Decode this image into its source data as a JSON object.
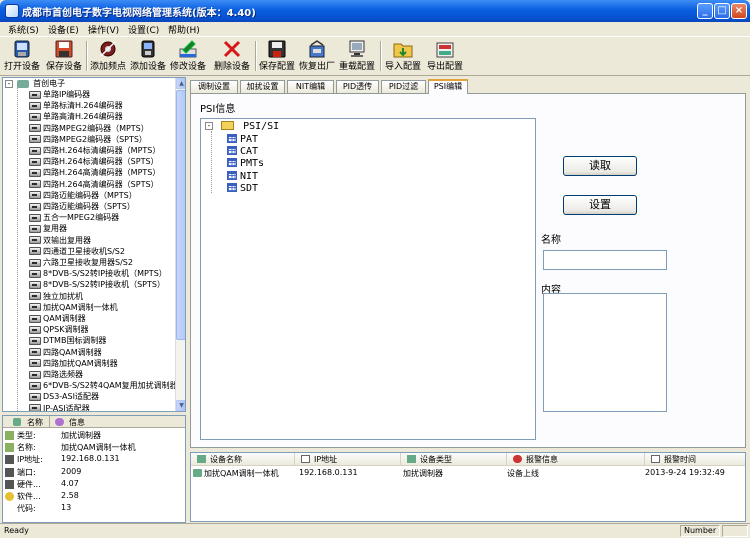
{
  "window": {
    "title": "成都市首创电子数字电视网络管理系统(版本：4.40)",
    "controls": {
      "minimize": "_",
      "maximize": "□",
      "close": "×"
    }
  },
  "menu": [
    "系统(S)",
    "设备(E)",
    "操作(V)",
    "设置(C)",
    "帮助(H)"
  ],
  "toolbar": [
    {
      "label": "打开设备",
      "icon": "open-device-icon"
    },
    {
      "label": "保存设备",
      "icon": "save-device-icon"
    },
    {
      "label": "添加频点",
      "icon": "add-frequency-icon"
    },
    {
      "label": "添加设备",
      "icon": "add-device-icon"
    },
    {
      "label": "修改设备",
      "icon": "edit-device-icon"
    },
    {
      "label": "删除设备",
      "icon": "delete-device-icon"
    },
    {
      "label": "保存配置",
      "icon": "save-config-icon"
    },
    {
      "label": "恢复出厂",
      "icon": "factory-reset-icon"
    },
    {
      "label": "重载配置",
      "icon": "reload-config-icon"
    },
    {
      "label": "导入配置",
      "icon": "import-config-icon"
    },
    {
      "label": "导出配置",
      "icon": "export-config-icon"
    }
  ],
  "tree": {
    "root": "首创电子",
    "items": [
      "单路IP编码器",
      "单路标清H.264编码器",
      "单路高清H.264编码器",
      "四路MPEG2编码器（MPTS）",
      "四路MPEG2编码器（SPTS）",
      "四路H.264标清编码器（MPTS）",
      "四路H.264标清编码器（SPTS）",
      "四路H.264高清编码器（MPTS）",
      "四路H.264高清编码器（SPTS）",
      "四路迈能编码器（MPTS）",
      "四路迈能编码器（SPTS）",
      "五合一MPEG2编码器",
      "复用器",
      "双输出复用器",
      "四通道卫星接收机S/S2",
      "六路卫星接收复用器S/S2",
      "8*DVB-S/S2转IP接收机（MPTS）",
      "8*DVB-S/S2转IP接收机（SPTS）",
      "独立加扰机",
      "加扰QAM调制一体机",
      "QAM调制器",
      "QPSK调制器",
      "DTMB国标调制器",
      "四路QAM调制器",
      "四路加扰QAM调制器",
      "四路选频器",
      "6*DVB-S/S2转4QAM复用加扰调制器",
      "DS3-ASI适配器",
      "IP-ASI适配器"
    ],
    "selected_index": 19
  },
  "info_panel": {
    "headers": [
      "名称",
      "信息"
    ],
    "rows": [
      {
        "key": "类型:",
        "value": "加扰调制器"
      },
      {
        "key": "名称:",
        "value": "加扰QAM调制一体机"
      },
      {
        "key": "IP地址:",
        "value": "192.168.0.131"
      },
      {
        "key": "端口:",
        "value": "2009"
      },
      {
        "key": "硬件...",
        "value": "4.07"
      },
      {
        "key": "软件...",
        "value": "2.58"
      },
      {
        "key": "代码:",
        "value": "13"
      }
    ]
  },
  "tabs": [
    "调制设置",
    "加扰设置",
    "NIT编辑",
    "PID透传",
    "PID过滤",
    "PSI编辑"
  ],
  "active_tab": 5,
  "psi": {
    "label": "PSI信息",
    "root": "PSI/SI",
    "children": [
      "PAT",
      "CAT",
      "PMTs",
      "NIT",
      "SDT"
    ],
    "read_button": "读取",
    "set_button": "设置",
    "name_label": "名称",
    "name_value": "",
    "content_label": "内容",
    "content_value": ""
  },
  "device_grid": {
    "columns": [
      "设备名称",
      "IP地址",
      "设备类型",
      "报警信息",
      "报警时间"
    ],
    "rows": [
      [
        "加扰QAM调制一体机",
        "192.168.0.131",
        "加扰调制器",
        "设备上线",
        "2013-9-24 19:32:49"
      ]
    ]
  },
  "status": {
    "left": "Ready",
    "right": "Number"
  }
}
